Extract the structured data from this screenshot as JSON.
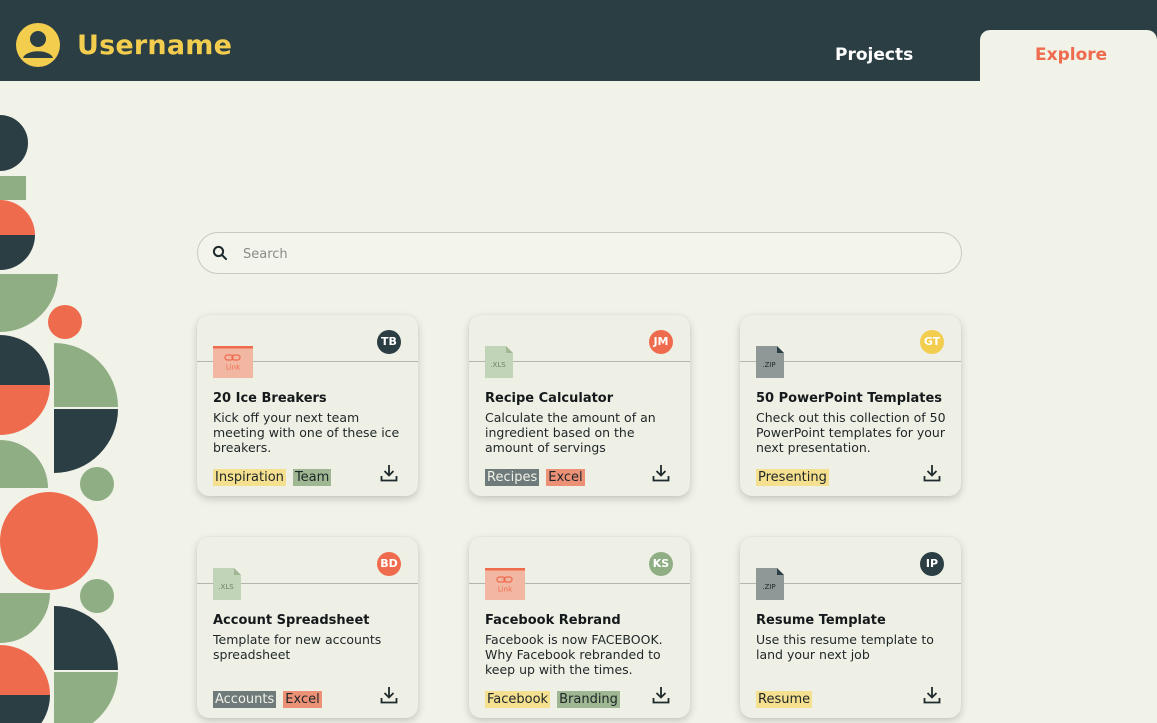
{
  "header": {
    "username": "Username",
    "nav": {
      "projects": "Projects",
      "explore": "Explore"
    },
    "colors": {
      "bg": "#2b3e44",
      "username": "#f3cd4e",
      "active_tab": "#ef6b4d"
    }
  },
  "search": {
    "placeholder": "Search",
    "value": ""
  },
  "cards": [
    {
      "title": "20 Ice Breakers",
      "description": "Kick off your next team meeting with one of these ice breakers.",
      "author_initials": "TB",
      "badge_color": "#2b3e44",
      "file_type": "link",
      "file_label": "Link",
      "tags": [
        {
          "label": "Inspiration",
          "color": "yellow"
        },
        {
          "label": "Team",
          "color": "green"
        }
      ]
    },
    {
      "title": "Recipe Calculator",
      "description": "Calculate the amount of an ingredient based on the amount of servings",
      "author_initials": "JM",
      "badge_color": "#ef6b4d",
      "file_type": "xls",
      "file_label": ".XLS",
      "tags": [
        {
          "label": "Recipes",
          "color": "slate"
        },
        {
          "label": "Excel",
          "color": "coral"
        }
      ]
    },
    {
      "title": "50 PowerPoint Templates",
      "description": "Check out this collection of 50 PowerPoint templates for your next presentation.",
      "author_initials": "GT",
      "badge_color": "#f3cd4e",
      "file_type": "zip",
      "file_label": ".ZIP",
      "tags": [
        {
          "label": "Presenting",
          "color": "yellow"
        }
      ]
    },
    {
      "title": "Account Spreadsheet",
      "description": "Template for new accounts spreadsheet",
      "author_initials": "BD",
      "badge_color": "#ef6b4d",
      "file_type": "xls",
      "file_label": ".XLS",
      "tags": [
        {
          "label": "Accounts",
          "color": "slate"
        },
        {
          "label": "Excel",
          "color": "coral"
        }
      ]
    },
    {
      "title": "Facebook Rebrand",
      "description": "Facebook is now FACEBOOK. Why Facebook rebranded to keep up with the times.",
      "author_initials": "KS",
      "badge_color": "#8fae84",
      "file_type": "link",
      "file_label": "Link",
      "tags": [
        {
          "label": "Facebook",
          "color": "yellow"
        },
        {
          "label": "Branding",
          "color": "green"
        }
      ]
    },
    {
      "title": "Resume Template",
      "description": "Use this resume template to land your next job",
      "author_initials": "IP",
      "badge_color": "#2b3e44",
      "file_type": "zip",
      "file_label": ".ZIP",
      "tags": [
        {
          "label": "Resume",
          "color": "yellow"
        }
      ]
    }
  ]
}
